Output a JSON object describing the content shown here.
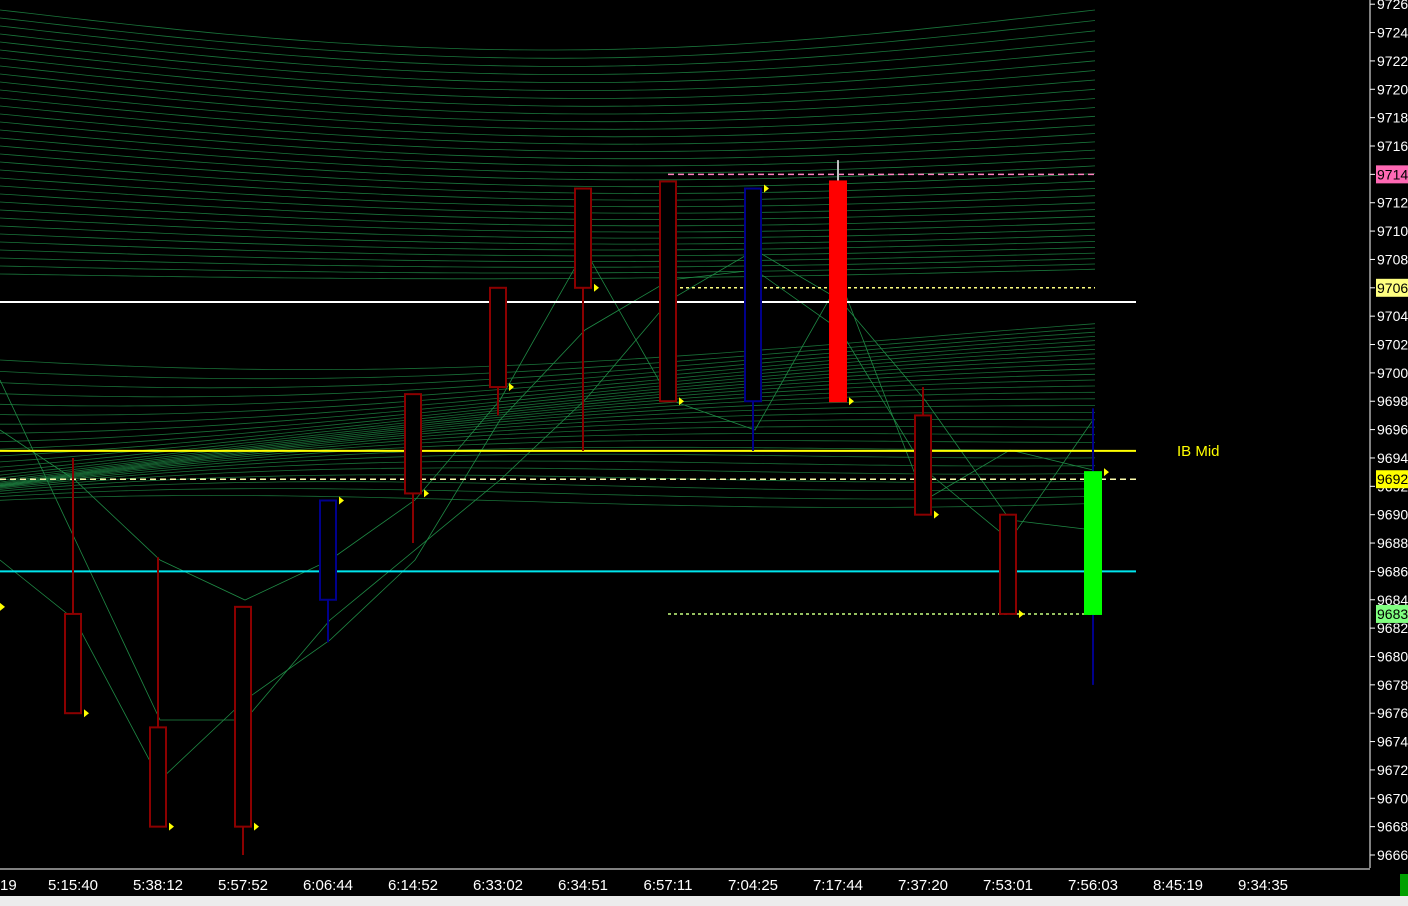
{
  "chart_data": {
    "type": "candlestick",
    "ylim": [
      9665,
      9726
    ],
    "y_ticks": [
      "9726",
      "9724",
      "9722",
      "9720",
      "9718",
      "9716",
      "9714",
      "9712",
      "9710",
      "9708",
      "9706",
      "9704",
      "9702",
      "9700",
      "9698",
      "9696",
      "9694",
      "9692",
      "9690",
      "9688",
      "9686",
      "9684",
      "9682",
      "9680",
      "9678",
      "9676",
      "9674",
      "9672",
      "9670",
      "9668",
      "9666"
    ],
    "x_ticks": [
      "19",
      "5:15:40",
      "5:38:12",
      "5:57:52",
      "6:06:44",
      "6:14:52",
      "6:33:02",
      "6:34:51",
      "6:57:11",
      "7:04:25",
      "7:17:44",
      "7:37:20",
      "7:53:01",
      "7:56:03",
      "8:45:19",
      "9:34:35"
    ],
    "candles": [
      {
        "time": "5:15:40",
        "open": 9683,
        "high": 9694,
        "low": 9683,
        "close": 9676,
        "color": "#8b0000",
        "fill": false
      },
      {
        "time": "5:38:12",
        "open": 9675,
        "high": 9687,
        "low": 9675,
        "close": 9668,
        "color": "#8b0000",
        "fill": false
      },
      {
        "time": "5:57:52",
        "open": 9683.5,
        "high": 9683.5,
        "low": 9666,
        "close": 9668,
        "color": "#8b0000",
        "fill": false
      },
      {
        "time": "6:06:44",
        "open": 9684,
        "high": 9691,
        "low": 9681,
        "close": 9691,
        "color": "#00008b",
        "fill": false
      },
      {
        "time": "6:14:52",
        "open": 9698.5,
        "high": 9698.5,
        "low": 9688,
        "close": 9691.5,
        "color": "#8b0000",
        "fill": false
      },
      {
        "time": "6:33:02",
        "open": 9706,
        "high": 9706,
        "low": 9697,
        "close": 9699,
        "color": "#8b0000",
        "fill": false
      },
      {
        "time": "6:34:51",
        "open": 9713,
        "high": 9713,
        "low": 9694.5,
        "close": 9706,
        "color": "#8b0000",
        "fill": false
      },
      {
        "time": "6:57:11",
        "open": 9713.5,
        "high": 9713.5,
        "low": 9698,
        "close": 9698,
        "color": "#8b0000",
        "fill": false
      },
      {
        "time": "7:04:25",
        "open": 9698,
        "high": 9713,
        "low": 9694.5,
        "close": 9713,
        "color": "#00008b",
        "fill": false
      },
      {
        "time": "7:17:44",
        "open": 9713.5,
        "high": 9715,
        "low": 9698,
        "close": 9698,
        "color": "#ff0000",
        "fill": true,
        "wick": "#c0c0c0"
      },
      {
        "time": "7:37:20",
        "open": 9697,
        "high": 9699,
        "low": 9690,
        "close": 9690,
        "color": "#8b0000",
        "fill": false
      },
      {
        "time": "7:53:01",
        "open": 9690,
        "high": 9690,
        "low": 9683,
        "close": 9683,
        "color": "#8b0000",
        "fill": false
      },
      {
        "time": "7:56:03",
        "open": 9683,
        "high": 9697.5,
        "low": 9678,
        "close": 9693,
        "color": "#00ff00",
        "fill": true,
        "wick": "#00008b"
      }
    ],
    "levels": [
      {
        "value": 9705,
        "color": "#ffffff",
        "style": "solid"
      },
      {
        "value": 9694.5,
        "color": "#ffff00",
        "style": "solid",
        "label": "IB Mid"
      },
      {
        "value": 9686,
        "color": "#00e5ee",
        "style": "solid"
      },
      {
        "value": 9692.5,
        "color": "#ffffb0",
        "style": "dashed"
      },
      {
        "value": 9714,
        "color": "#ff80c0",
        "style": "dashed"
      },
      {
        "value": 9706,
        "color": "#ffff80",
        "style": "dotted"
      },
      {
        "value": 9683,
        "color": "#c8ff80",
        "style": "dotted"
      }
    ],
    "price_tags": [
      {
        "text": "9714",
        "value": 9714,
        "bg": "#ff69b4"
      },
      {
        "text": "9706",
        "value": 9706,
        "bg": "#ffff80"
      },
      {
        "text": "9692",
        "value": 9692.5,
        "bg": "#ffff00"
      },
      {
        "text": "9683",
        "value": 9683,
        "bg": "#80ff80"
      }
    ],
    "grid": false
  },
  "colors": {
    "background": "#000000",
    "axis_text": "#ffffff",
    "mesh": "#1f8a45",
    "ib_mid_label": "#ffff00"
  }
}
